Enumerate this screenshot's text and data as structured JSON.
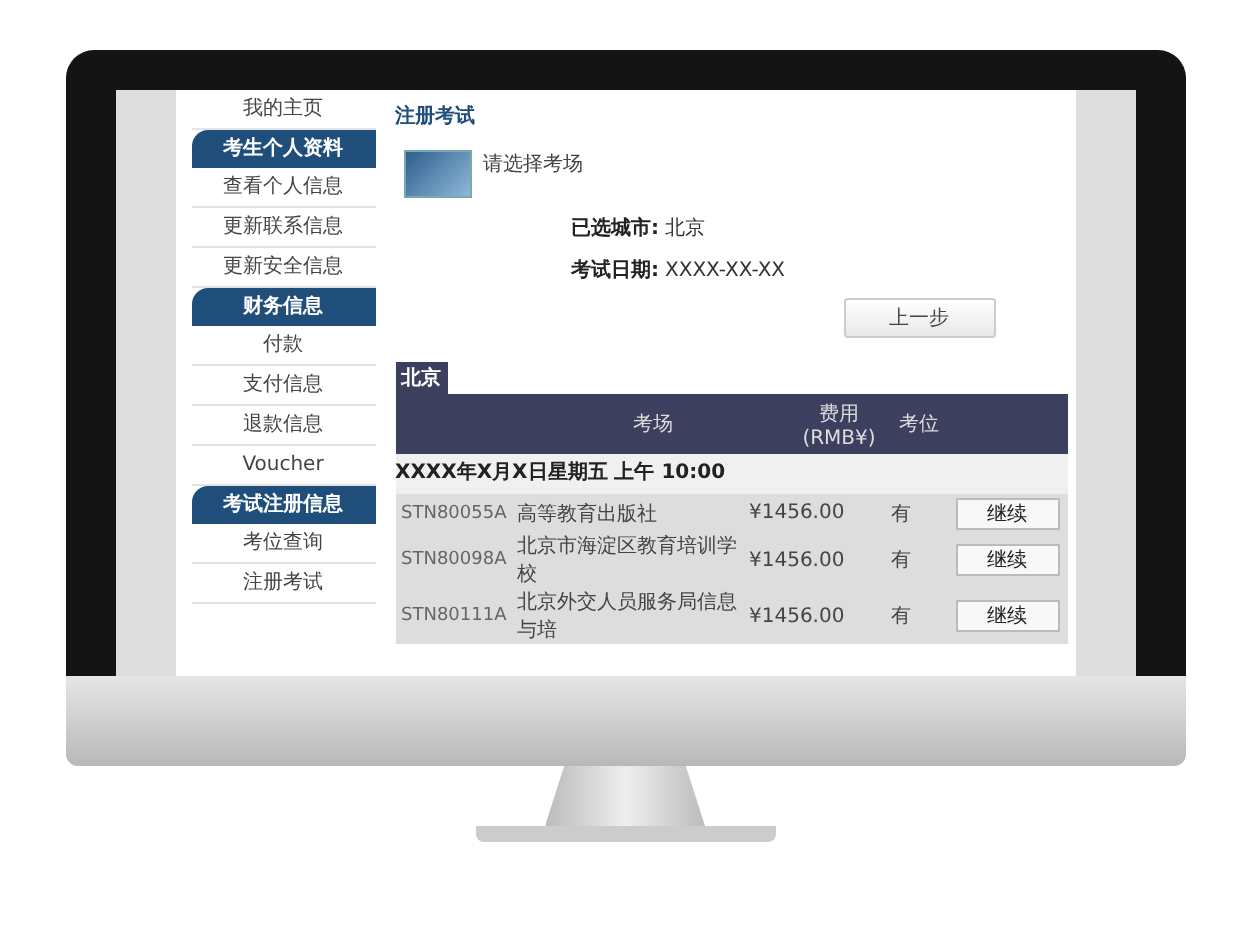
{
  "sidebar": {
    "items": [
      {
        "kind": "link",
        "label": "我的主页"
      },
      {
        "kind": "header",
        "label": "考生个人资料"
      },
      {
        "kind": "link",
        "label": "查看个人信息"
      },
      {
        "kind": "link",
        "label": "更新联系信息"
      },
      {
        "kind": "link",
        "label": "更新安全信息"
      },
      {
        "kind": "header",
        "label": "财务信息"
      },
      {
        "kind": "link",
        "label": "付款"
      },
      {
        "kind": "link",
        "label": "支付信息"
      },
      {
        "kind": "link",
        "label": "退款信息"
      },
      {
        "kind": "link",
        "label": "Voucher"
      },
      {
        "kind": "header",
        "label": "考试注册信息"
      },
      {
        "kind": "link",
        "label": "考位查询"
      },
      {
        "kind": "link",
        "label": "注册考试"
      }
    ]
  },
  "main": {
    "title": "注册考试",
    "prompt": "请选择考场",
    "selection": [
      {
        "label": "已选城市:",
        "value": "北京"
      },
      {
        "label": "考试日期:",
        "value": "XXXX-XX-XX"
      }
    ],
    "back_button": "上一步",
    "tab": "北京",
    "table": {
      "columns": [
        "考场",
        "费用\n(RMB¥)",
        "考位"
      ],
      "group": "XXXX年X月X日星期五 上午 10:00",
      "rows": [
        {
          "id": "STN80055A",
          "name": "高等教育出版社",
          "fee": "¥1456.00",
          "seats": "有",
          "action": "继续"
        },
        {
          "id": "STN80098A",
          "name": "北京市海淀区教育培训学校",
          "fee": "¥1456.00",
          "seats": "有",
          "action": "继续"
        },
        {
          "id": "STN80111A",
          "name": "北京外交人员服务局信息与培",
          "fee": "¥1456.00",
          "seats": "有",
          "action": "继续"
        }
      ]
    }
  }
}
